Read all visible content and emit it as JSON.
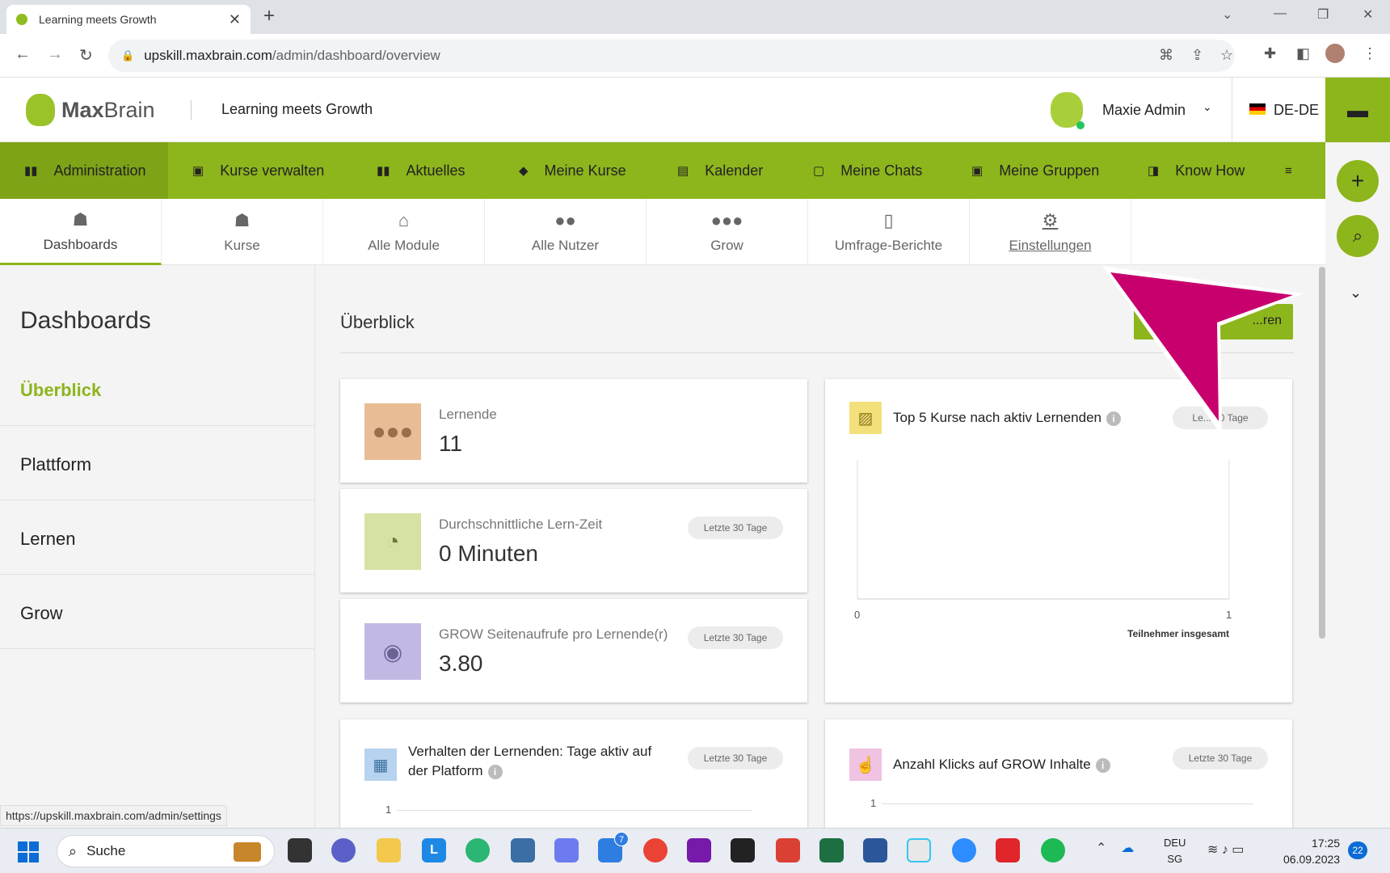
{
  "browser": {
    "tab_title": "Learning meets Growth",
    "new_tab": "+",
    "url_host": "upskill.maxbrain.com",
    "url_path": "/admin/dashboard/overview"
  },
  "header": {
    "logo_bold": "Max",
    "logo_light": "Brain",
    "tagline": "Learning meets Growth",
    "user_name": "Maxie Admin",
    "language": "DE-DE"
  },
  "main_nav": [
    {
      "label": "Administration",
      "icon": "dashboard-icon"
    },
    {
      "label": "Kurse verwalten",
      "icon": "id-card-icon"
    },
    {
      "label": "Aktuelles",
      "icon": "dashboard-icon"
    },
    {
      "label": "Meine Kurse",
      "icon": "graduation-cap-icon"
    },
    {
      "label": "Kalender",
      "icon": "calendar-icon"
    },
    {
      "label": "Meine Chats",
      "icon": "chat-icon"
    },
    {
      "label": "Meine Gruppen",
      "icon": "id-card-icon"
    },
    {
      "label": "Know How",
      "icon": "book-icon"
    }
  ],
  "sub_tabs": [
    {
      "label": "Dashboards",
      "icon": "book-stack-icon"
    },
    {
      "label": "Kurse",
      "icon": "book-stack-icon"
    },
    {
      "label": "Alle Module",
      "icon": "bank-icon"
    },
    {
      "label": "Alle Nutzer",
      "icon": "users-icon"
    },
    {
      "label": "Grow",
      "icon": "group-icon"
    },
    {
      "label": "Umfrage-Berichte",
      "icon": "report-icon"
    },
    {
      "label": "Einstellungen",
      "icon": "gears-icon"
    }
  ],
  "sidebar": {
    "title": "Dashboards",
    "items": [
      "Überblick",
      "Plattform",
      "Lernen",
      "Grow"
    ]
  },
  "page": {
    "title": "Überblick",
    "button_label": "...ren"
  },
  "kpis": [
    {
      "label": "Lernende",
      "value": "11",
      "color": "#e8bd95"
    },
    {
      "label": "Durchschnittliche Lern-Zeit",
      "value": "0 Minuten",
      "pill": "Letzte 30 Tage",
      "color": "#d5e2a4"
    },
    {
      "label": "GROW Seitenaufrufe pro Lernende(r)",
      "value": "3.80",
      "pill": "Letzte 30 Tage",
      "color": "#c3b8e3"
    }
  ],
  "top_courses": {
    "title": "Top 5 Kurse nach aktiv Lernenden",
    "pill": "Le... 30 Tage",
    "x_min": "0",
    "x_max": "1",
    "x_label": "Teilnehmer insgesamt",
    "color": "#f4e07a"
  },
  "behavior": {
    "title_line1": "Verhalten der Lernenden: Tage aktiv auf",
    "title_line2": "der Platform",
    "pill": "Letzte 30 Tage",
    "y_tick": "1",
    "color": "#b7d3ef"
  },
  "clicks": {
    "title": "Anzahl Klicks auf GROW Inhalte",
    "pill": "Letzte 30 Tage",
    "y_tick": "1",
    "color": "#f0c3e2"
  },
  "accent_color": "#8db51c",
  "status_url": "https://upskill.maxbrain.com/admin/settings",
  "taskbar": {
    "search": "Suche",
    "lang_line1": "DEU",
    "lang_line2": "SG",
    "time": "17:25",
    "date": "06.09.2023",
    "notifications": "22",
    "todo_badge": "7"
  }
}
